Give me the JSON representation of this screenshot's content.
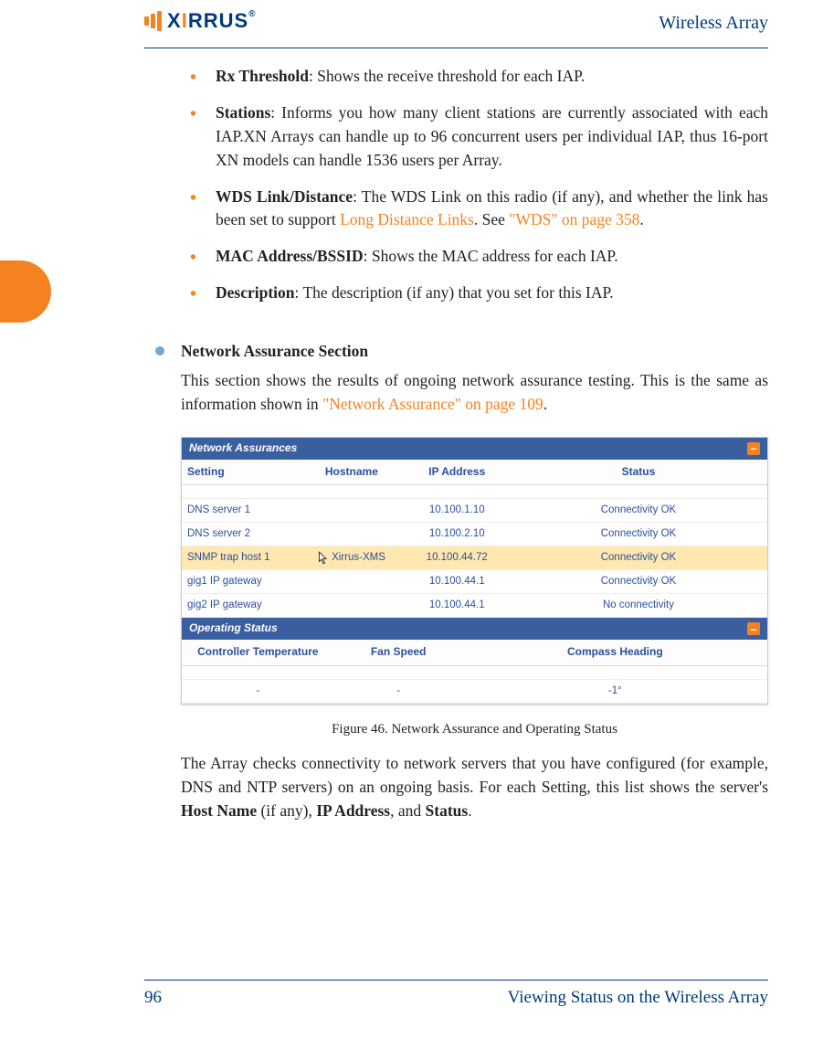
{
  "header": {
    "brand_prefix": "X",
    "brand_middle": "I",
    "brand_suffix": "RRUS",
    "title": "Wireless Array"
  },
  "bullets": [
    {
      "term": "Rx Threshold",
      "text": ": Shows the receive threshold for each IAP."
    },
    {
      "term": "Stations",
      "text": ": Informs you how many client stations are currently associated with each IAP.XN Arrays can handle up to 96 concurrent users per individual IAP, thus 16-port XN models can handle 1536 users per Array."
    },
    {
      "term": "WDS Link/Distance",
      "text_a": ": The WDS Link on this radio (if any), and whether the link has been set to support ",
      "link1": "Long Distance Links",
      "text_b": ". See ",
      "link2": "\"WDS\" on page 358",
      "text_c": "."
    },
    {
      "term": "MAC Address/BSSID",
      "text": ": Shows the MAC address for each IAP."
    },
    {
      "term": "Description",
      "text": ": The description (if any) that you set for this IAP."
    }
  ],
  "section": {
    "title": "Network Assurance Section",
    "body_a": "This section shows the results of ongoing network assurance testing. This is the same as information shown in ",
    "body_link": "\"Network Assurance\" on page 109",
    "body_b": "."
  },
  "figure": {
    "panel1_title": "Network Assurances",
    "headers1": [
      "Setting",
      "Hostname",
      "IP Address",
      "Status"
    ],
    "rows1": [
      {
        "setting": "DNS server 1",
        "host": "",
        "ip": "10.100.1.10",
        "status": "Connectivity OK",
        "hl": false
      },
      {
        "setting": "DNS server 2",
        "host": "",
        "ip": "10.100.2.10",
        "status": "Connectivity OK",
        "hl": false
      },
      {
        "setting": "SNMP trap host 1",
        "host": "Xirrus-XMS",
        "ip": "10.100.44.72",
        "status": "Connectivity OK",
        "hl": true
      },
      {
        "setting": "gig1 IP gateway",
        "host": "",
        "ip": "10.100.44.1",
        "status": "Connectivity OK",
        "hl": false
      },
      {
        "setting": "gig2 IP gateway",
        "host": "",
        "ip": "10.100.44.1",
        "status": "No connectivity",
        "hl": false
      }
    ],
    "panel2_title": "Operating Status",
    "headers2": [
      "Controller Temperature",
      "Fan Speed",
      "Compass Heading"
    ],
    "row2": {
      "temp": "-",
      "fan": "-",
      "heading": "-1°"
    },
    "caption": "Figure 46. Network Assurance and Operating Status"
  },
  "para2_a": "The Array checks connectivity to network servers that you have configured (for example, DNS and NTP servers) on an ongoing basis. For each Setting, this list shows the server's ",
  "para2_b": "Host Name",
  "para2_c": " (if any), ",
  "para2_d": "IP Address",
  "para2_e": ", and ",
  "para2_f": "Status",
  "para2_g": ".",
  "footer": {
    "page": "96",
    "chapter": "Viewing Status on the Wireless Array"
  }
}
